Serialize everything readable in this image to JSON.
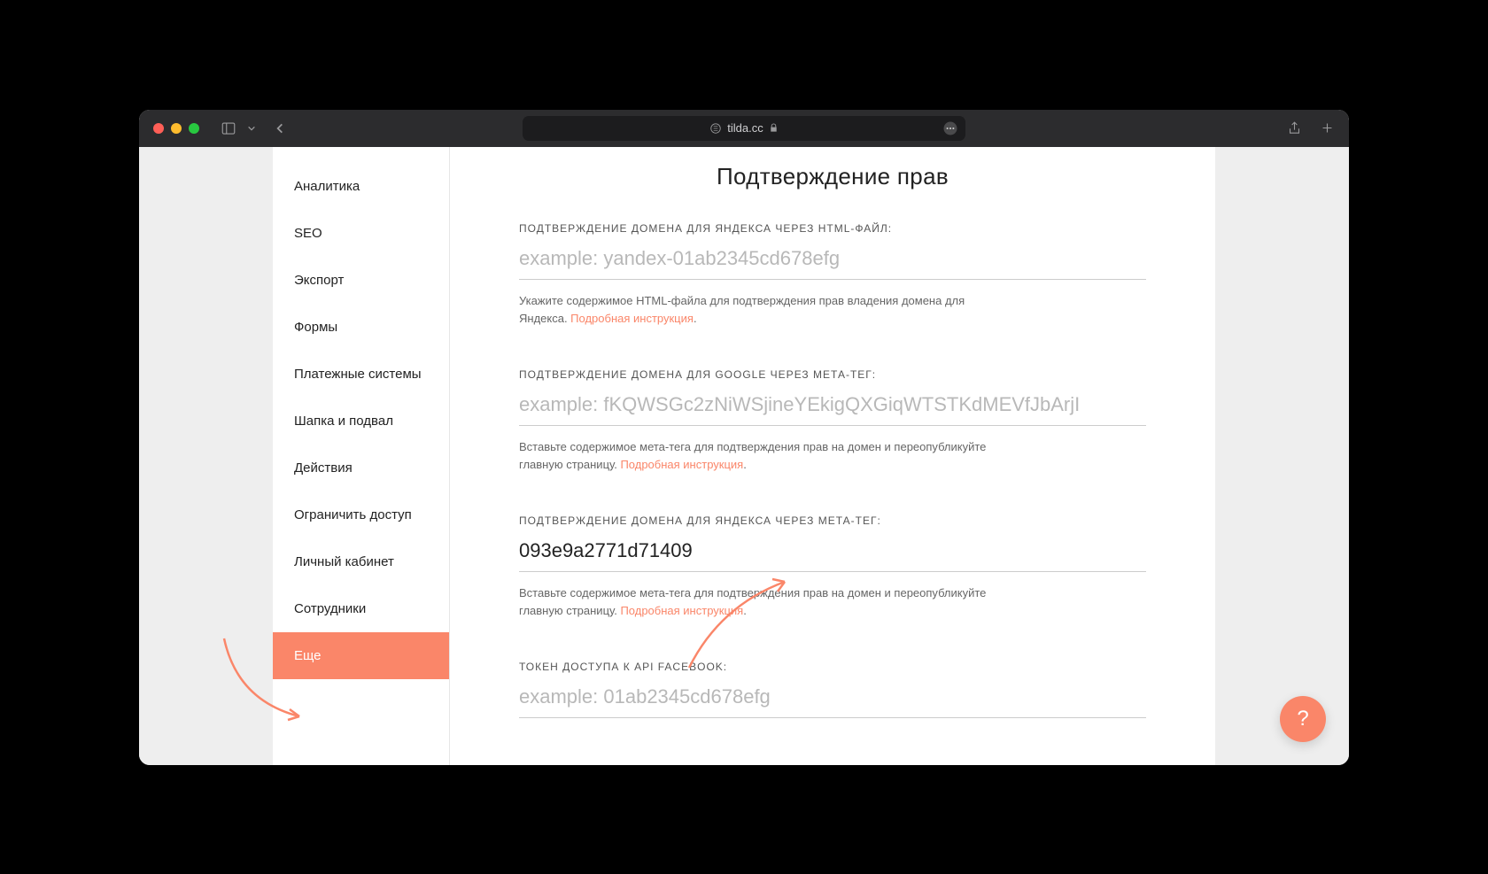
{
  "browser": {
    "url": "tilda.cc"
  },
  "sidebar": {
    "items": [
      "Аналитика",
      "SEO",
      "Экспорт",
      "Формы",
      "Платежные системы",
      "Шапка и подвал",
      "Действия",
      "Ограничить доступ",
      "Личный кабинет",
      "Сотрудники",
      "Еще"
    ],
    "active_index": 10
  },
  "main": {
    "title": "Подтверждение прав",
    "fields": [
      {
        "label": "ПОДТВЕРЖДЕНИЕ ДОМЕНА ДЛЯ ЯНДЕКСА ЧЕРЕЗ HTML-ФАЙЛ:",
        "placeholder": "example: yandex-01ab2345cd678efg",
        "value": "",
        "desc_pre": "Укажите содержимое HTML-файла для подтверждения прав владения домена для Яндекса. ",
        "link": "Подробная инструкция",
        "desc_post": "."
      },
      {
        "label": "ПОДТВЕРЖДЕНИЕ ДОМЕНА ДЛЯ GOOGLE ЧЕРЕЗ МЕТА-ТЕГ:",
        "placeholder": "example: fKQWSGc2zNiWSjineYEkigQXGiqWTSTKdMEVfJbArjI",
        "value": "",
        "desc_pre": "Вставьте содержимое мета-тега для подтверждения прав на домен и переопубликуйте главную страницу. ",
        "link": "Подробная инструкция",
        "desc_post": "."
      },
      {
        "label": "ПОДТВЕРЖДЕНИЕ ДОМЕНА ДЛЯ ЯНДЕКСА ЧЕРЕЗ МЕТА-ТЕГ:",
        "placeholder": "",
        "value": "093e9a2771d71409",
        "desc_pre": "Вставьте содержимое мета-тега для подтверждения прав на домен и переопубликуйте главную страницу. ",
        "link": "Подробная инструкция",
        "desc_post": "."
      },
      {
        "label": "ТОКЕН ДОСТУПА К API FACEBOOK:",
        "placeholder": "example: 01ab2345cd678efg",
        "value": "",
        "desc_pre": "",
        "link": "",
        "desc_post": ""
      }
    ]
  },
  "help": {
    "label": "?"
  }
}
